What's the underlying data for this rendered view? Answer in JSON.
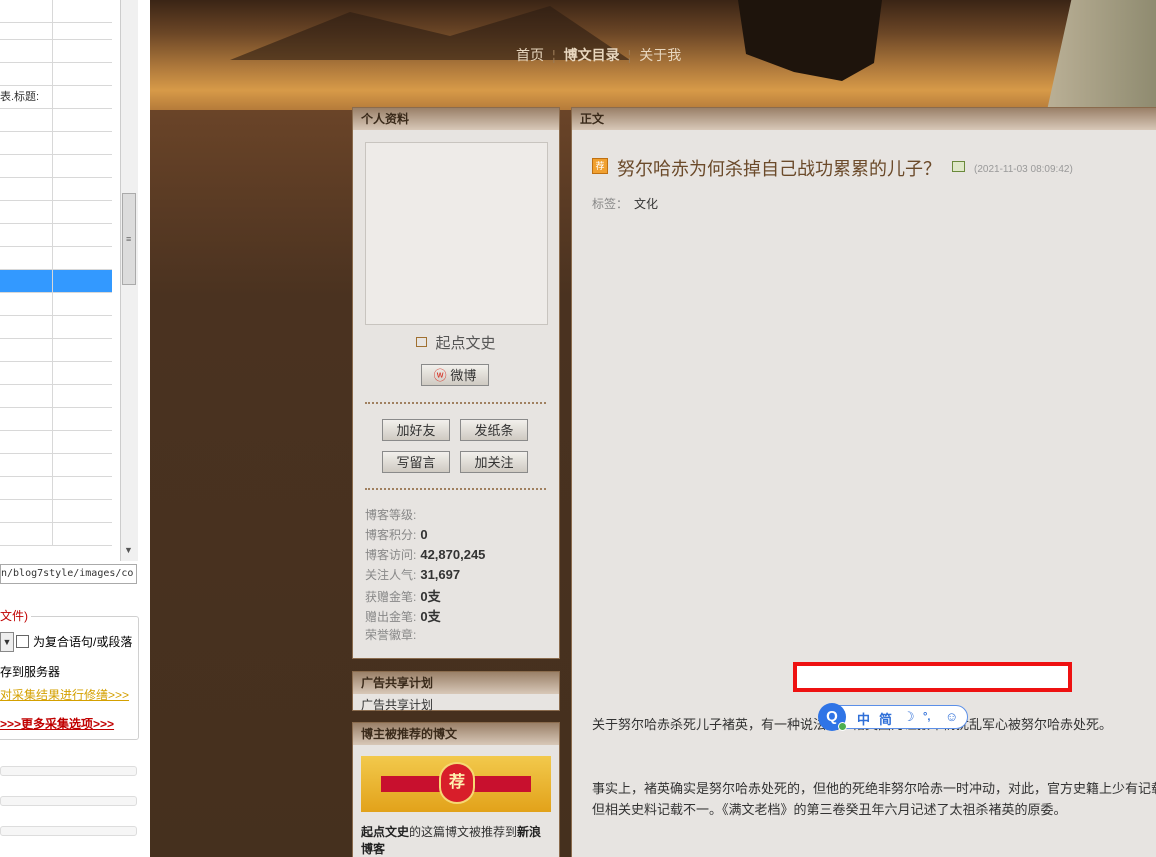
{
  "tool": {
    "row_text": "表.标题:",
    "url_text": "n/blog7style/images/co",
    "group_title": "文件)",
    "combo_arrow": "▼",
    "checkbox_label": "为复合语句/或段落",
    "to_server_text": "存到服务器",
    "fix_link": "对采集结果进行修缮>>>",
    "more_link": ">>>更多采集选项>>>"
  },
  "nav": {
    "home": "首页",
    "catalog": "博文目录",
    "about": "关于我"
  },
  "profile": {
    "title": "个人资料",
    "blog_name": "起点文史",
    "weibo_label": "微博",
    "add_friend": "加好友",
    "send_note": "发纸条",
    "write_msg": "写留言",
    "follow": "加关注",
    "stats": [
      {
        "label": "博客等级:",
        "value": ""
      },
      {
        "label": "博客积分:",
        "value": "0"
      },
      {
        "label": "博客访问:",
        "value": "42,870,245"
      },
      {
        "label": "关注人气:",
        "value": "31,697"
      },
      {
        "label": "获赠金笔:",
        "value": "0支"
      },
      {
        "label": "赠出金笔:",
        "value": "0支"
      },
      {
        "label": "荣誉徽章:",
        "value": ""
      }
    ]
  },
  "ad": {
    "title": "广告共享计划",
    "text": "广告共享计划"
  },
  "recommend": {
    "title": "博主被推荐的博文",
    "badge": "荐",
    "text_part1": "起点文史",
    "text_part2": "的这篇博文被推荐到",
    "text_part3": "新浪博客"
  },
  "post": {
    "section_title": "正文",
    "icon_text": "荐",
    "title": "努尔哈赤为何杀掉自己战功累累的儿子？",
    "date": "(2021-11-03 08:09:42)",
    "tag_label": "标签：",
    "tag": "文化",
    "para1": "关于努尔哈赤杀死儿子褚英，有一种说法是，褚英因为诬报军情扰乱军心被努尔哈赤处死。",
    "para2": "事实上，褚英确实是努尔哈赤处死的，但他的死绝非努尔哈赤一时冲动，对此，官方史籍上少有记载，但相关史料记载不一。《满文老档》的第三卷癸丑年六月记述了太祖杀褚英的原委。"
  },
  "ime": {
    "logo": "Q",
    "zh": "中",
    "simp": "简",
    "moon": "☽",
    "punct": "°,",
    "emoji": "☺"
  }
}
